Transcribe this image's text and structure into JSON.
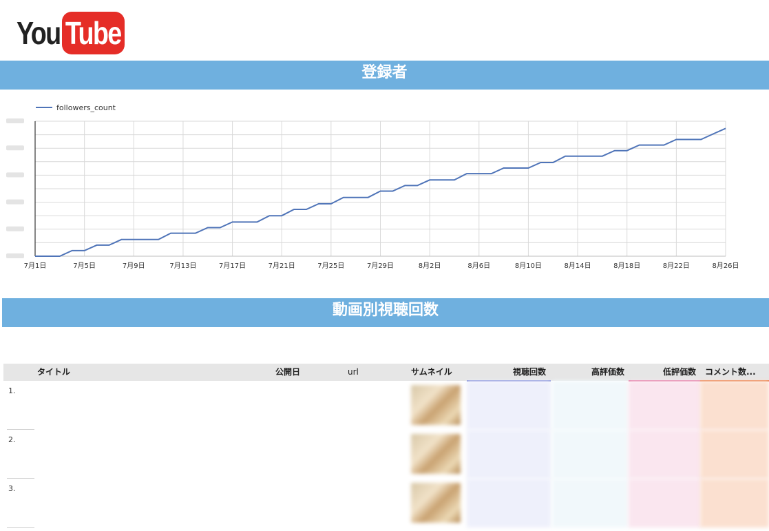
{
  "logo": {
    "you": "You",
    "tube": "Tube"
  },
  "sections": {
    "subscribers": "登録者",
    "views_by_video": "動画別視聴回数"
  },
  "chart_data": {
    "type": "line",
    "legend": "followers_count",
    "legend_position": "top-left",
    "grid": true,
    "x_ticks": [
      "7月1日",
      "7月5日",
      "7月9日",
      "7月13日",
      "7月17日",
      "7月21日",
      "7月25日",
      "7月29日",
      "8月2日",
      "8月6日",
      "8月10日",
      "8月14日",
      "8月18日",
      "8月22日",
      "8月26日"
    ],
    "series": [
      {
        "name": "followers_count",
        "color": "#4f74b8",
        "x_days": [
          0,
          2,
          3,
          4,
          5,
          6,
          7,
          8,
          9,
          10,
          11,
          12,
          13,
          14,
          15,
          16,
          17,
          18,
          19,
          20,
          21,
          22,
          23,
          24,
          25,
          26,
          27,
          28,
          29,
          30,
          31,
          32,
          33,
          34,
          35,
          36,
          37,
          38,
          39,
          40,
          41,
          42,
          43,
          44,
          45,
          46,
          47,
          48,
          49,
          50,
          51,
          52,
          53,
          54,
          55,
          56
        ],
        "y": [
          0,
          0,
          0.35,
          0.35,
          0.7,
          0.7,
          1.05,
          1.05,
          1.05,
          1.05,
          1.45,
          1.45,
          1.45,
          1.8,
          1.8,
          2.15,
          2.15,
          2.15,
          2.55,
          2.55,
          2.95,
          2.95,
          3.3,
          3.3,
          3.7,
          3.7,
          3.7,
          4.1,
          4.1,
          4.45,
          4.45,
          4.8,
          4.8,
          4.8,
          5.2,
          5.2,
          5.2,
          5.55,
          5.55,
          5.55,
          5.9,
          5.9,
          6.3,
          6.3,
          6.3,
          6.3,
          6.65,
          6.65,
          7.0,
          7.0,
          7.0,
          7.35,
          7.35,
          7.35,
          7.7,
          8.05
        ]
      }
    ],
    "ylim": [
      0,
      8.5
    ]
  },
  "table": {
    "headers": {
      "title": "タイトル",
      "published": "公開日",
      "url": "url",
      "thumbnail": "サムネイル",
      "views": "視聴回数",
      "likes": "高評価数",
      "dislikes": "低評価数",
      "comments": "コメント数..."
    },
    "header_colors": {
      "views": "#7b88d6",
      "dislikes": "#e06a9a",
      "comments": "#e8743b"
    },
    "rows": [
      {
        "num": "1."
      },
      {
        "num": "2."
      },
      {
        "num": "3."
      }
    ]
  }
}
